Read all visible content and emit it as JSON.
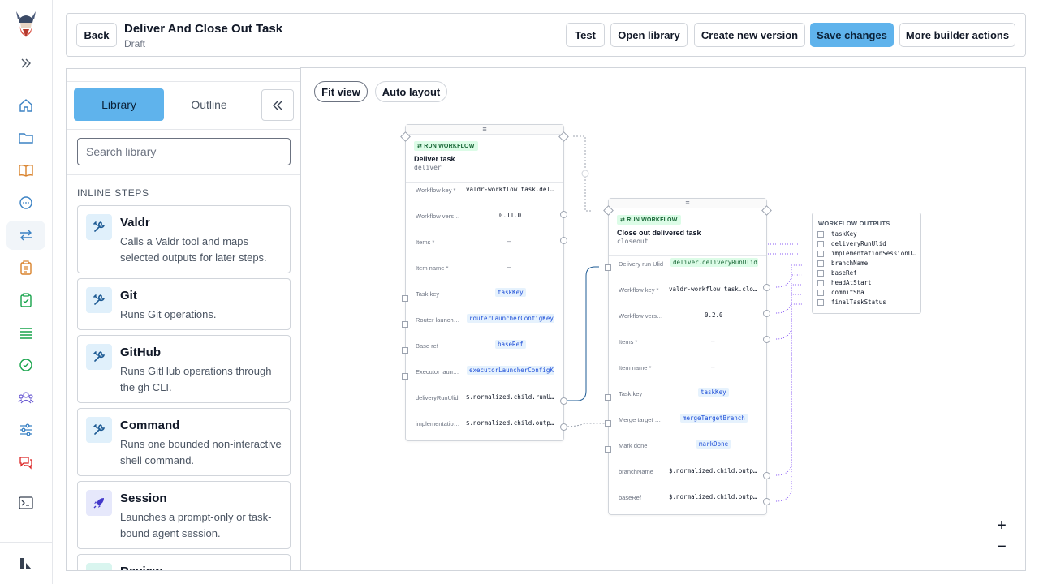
{
  "header": {
    "back_label": "Back",
    "title": "Deliver And Close Out Task",
    "subtitle": "Draft",
    "test_label": "Test",
    "open_library_label": "Open library",
    "new_version_label": "Create new version",
    "save_label": "Save changes",
    "more_label": "More builder actions"
  },
  "rail": {
    "icons": [
      "home-icon",
      "folder-icon",
      "book-icon",
      "chat-icon",
      "workflow-icon",
      "clipboard-icon",
      "clipboard-check-icon",
      "list-icon",
      "check-circle-icon",
      "users-icon",
      "sliders-icon",
      "messages-icon",
      "terminal-icon",
      "settings-icon"
    ],
    "accent": "#5fb3ec"
  },
  "library": {
    "tab_library": "Library",
    "tab_outline": "Outline",
    "search_placeholder": "Search library",
    "section_label": "INLINE STEPS",
    "items": [
      {
        "name": "Valdr",
        "desc": "Calls a Valdr tool and maps selected outputs for later steps.",
        "icon": "wrench-icon"
      },
      {
        "name": "Git",
        "desc": "Runs Git operations.",
        "icon": "wrench-icon"
      },
      {
        "name": "GitHub",
        "desc": "Runs GitHub operations through the gh CLI.",
        "icon": "wrench-icon"
      },
      {
        "name": "Command",
        "desc": "Runs one bounded non-interactive shell command.",
        "icon": "wrench-icon"
      },
      {
        "name": "Session",
        "desc": "Launches a prompt-only or task-bound agent session.",
        "icon": "rocket-icon"
      },
      {
        "name": "Review",
        "desc": "",
        "icon": "review-icon"
      }
    ]
  },
  "canvas": {
    "fit_view": "Fit view",
    "auto_layout": "Auto layout",
    "zoom_in": "+",
    "zoom_out": "−",
    "node1": {
      "grip": "≡",
      "badge": "RUN WORKFLOW",
      "name": "Deliver task",
      "slug": "deliver",
      "rows": [
        {
          "label": "Workflow key *",
          "value": "valdr-workflow.task.deliver"
        },
        {
          "label": "Workflow version",
          "value": "0.11.0"
        },
        {
          "label": "Items *",
          "value": "–"
        },
        {
          "label": "Item name *",
          "value": "–"
        },
        {
          "label": "Task key",
          "value": "taskKey"
        },
        {
          "label": "Router launcher config",
          "value": "routerLauncherConfigKey"
        },
        {
          "label": "Base ref",
          "value": "baseRef"
        },
        {
          "label": "Executor launcher config",
          "value": "executorLauncherConfigKey"
        },
        {
          "label": "deliveryRunUlid",
          "value": "$.normalized.child.runUlid"
        },
        {
          "label": "implementationSessionUlid",
          "value": "$.normalized.child.outputs"
        }
      ]
    },
    "node2": {
      "grip": "≡",
      "badge": "RUN WORKFLOW",
      "name": "Close out delivered task",
      "slug": "closeout",
      "rows": [
        {
          "label": "Delivery run Ulid",
          "value": "deliver.deliveryRunUlid"
        },
        {
          "label": "Workflow key *",
          "value": "valdr-workflow.task.closeout"
        },
        {
          "label": "Workflow version",
          "value": "0.2.0"
        },
        {
          "label": "Items *",
          "value": "–"
        },
        {
          "label": "Item name *",
          "value": "–"
        },
        {
          "label": "Task key",
          "value": "taskKey"
        },
        {
          "label": "Merge target branch",
          "value": "mergeTargetBranch"
        },
        {
          "label": "Mark done",
          "value": "markDone"
        },
        {
          "label": "branchName",
          "value": "$.normalized.child.outputs"
        },
        {
          "label": "baseRef",
          "value": "$.normalized.child.outputs"
        }
      ]
    },
    "outputs": {
      "title": "WORKFLOW OUTPUTS",
      "items": [
        "taskKey",
        "deliveryRunUlid",
        "implementationSessionUlid",
        "branchName",
        "baseRef",
        "headAtStart",
        "commitSha",
        "finalTaskStatus"
      ]
    }
  }
}
